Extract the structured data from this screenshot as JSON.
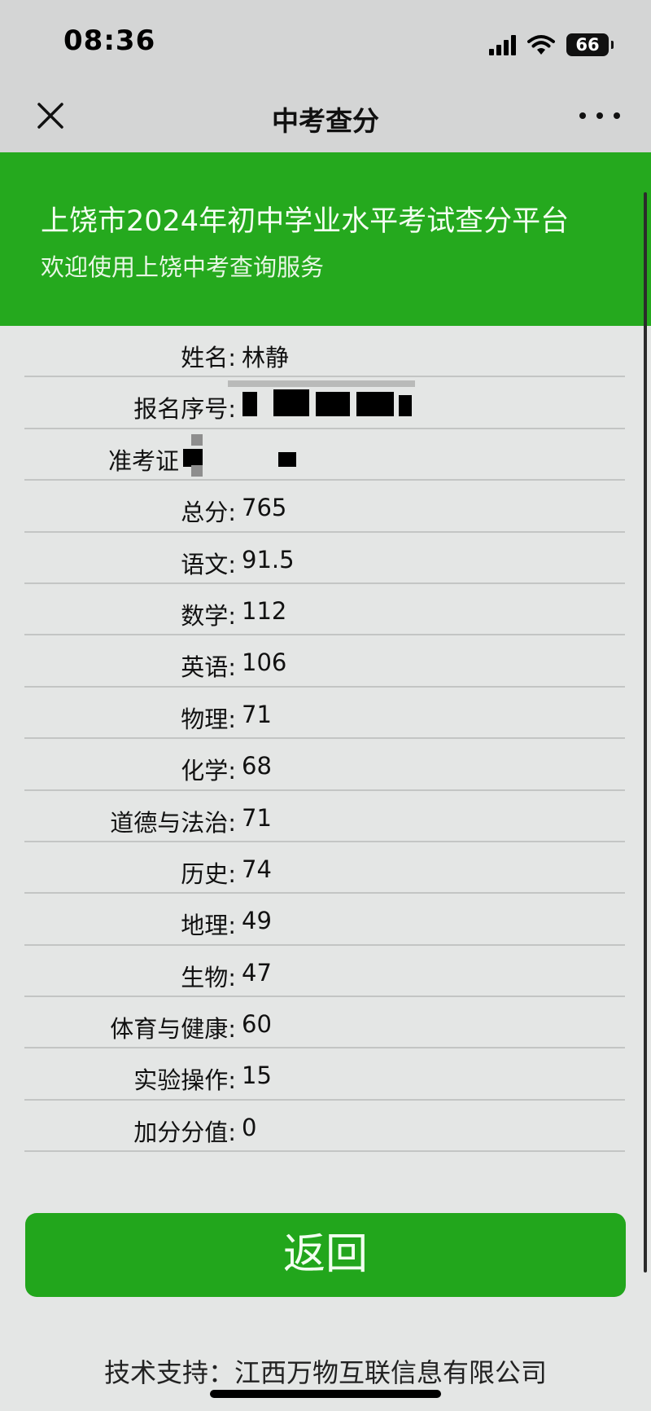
{
  "status_bar": {
    "time": "08:36",
    "battery": "66"
  },
  "nav": {
    "title": "中考查分"
  },
  "banner": {
    "title": "上饶市2024年初中学业水平考试查分平台",
    "subtitle": "欢迎使用上饶中考查询服务"
  },
  "rows": [
    {
      "label": "姓名:",
      "value": "林静"
    },
    {
      "label": "报名序号:",
      "value": ""
    },
    {
      "label": "准考证",
      "value": ""
    },
    {
      "label": "总分:",
      "value": "765"
    },
    {
      "label": "语文:",
      "value": "91.5"
    },
    {
      "label": "数学:",
      "value": "112"
    },
    {
      "label": "英语:",
      "value": "106"
    },
    {
      "label": "物理:",
      "value": "71"
    },
    {
      "label": "化学:",
      "value": "68"
    },
    {
      "label": "道德与法治:",
      "value": "71"
    },
    {
      "label": "历史:",
      "value": "74"
    },
    {
      "label": "地理:",
      "value": "49"
    },
    {
      "label": "生物:",
      "value": "47"
    },
    {
      "label": "体育与健康:",
      "value": "60"
    },
    {
      "label": "实验操作:",
      "value": "15"
    },
    {
      "label": "加分分值:",
      "value": "0"
    }
  ],
  "return_button": {
    "label": "返回"
  },
  "footer": {
    "text": "技术支持：江西万物互联信息有限公司"
  }
}
